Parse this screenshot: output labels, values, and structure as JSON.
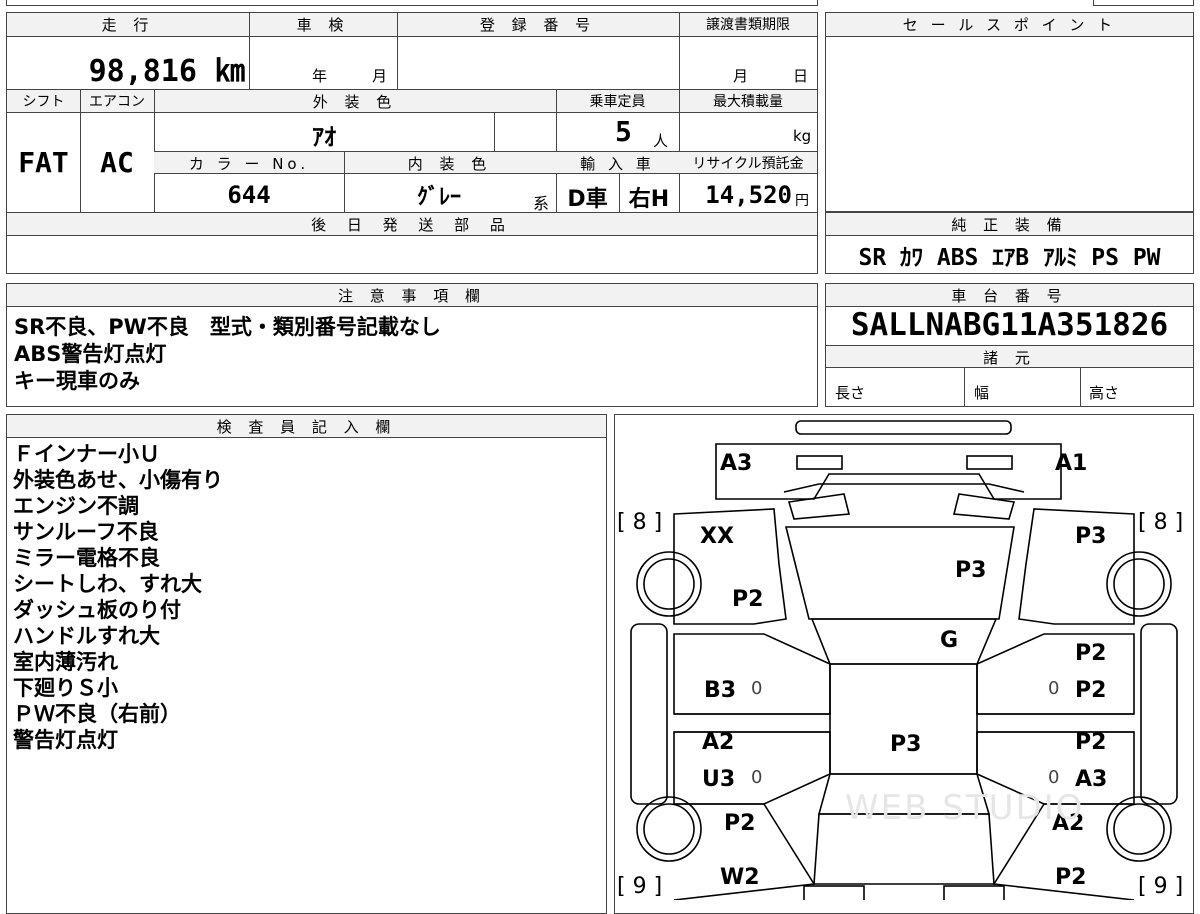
{
  "header_row": {
    "mileage_label": "走 行",
    "inspection_label": "車 検",
    "registration_label": "登 録 番 号",
    "transfer_deadline_label": "譲渡書類期限",
    "mileage_value": "98,816 ㎞",
    "inspection_year_unit": "年",
    "inspection_month_unit": "月",
    "transfer_month_unit": "月",
    "transfer_day_unit": "日"
  },
  "spec_row": {
    "shift_label": "シフト",
    "aircon_label": "エアコン",
    "exterior_color_label": "外 装 色",
    "capacity_label": "乗車定員",
    "max_load_label": "最大積載量",
    "shift_value": "FAT",
    "aircon_value": "AC",
    "exterior_color_value": "ｱｵ",
    "capacity_value": "5",
    "capacity_unit": "人",
    "max_load_unit": "kg",
    "color_no_label": "カ ラ ー No.",
    "interior_color_label": "内 装 色",
    "import_label": "輸 入 車",
    "recycle_label": "リサイクル預託金",
    "color_no_value": "644",
    "interior_color_value": "ｸﾞﾚｰ",
    "interior_suffix": "系",
    "import_value_1": "D車",
    "import_value_2": "右H",
    "recycle_value": "14,520",
    "recycle_unit": "円"
  },
  "later_parts_label": "後 日 発 送 部 品",
  "sales_point_label": "セ ー ル ス ポ イ ン ト",
  "genuine_equipment": {
    "label": "純 正 装 備",
    "value": "SR ｶﾜ ABS ｴｱB ｱﾙﾐ PS PW"
  },
  "notes": {
    "label": "注 意 事 項 欄",
    "lines": [
      "SR不良、PW不良　型式・類別番号記載なし",
      "ABS警告灯点灯",
      "キー現車のみ"
    ]
  },
  "chassis": {
    "label": "車 台 番 号",
    "value": "SALLNABG11A351826"
  },
  "specs": {
    "label": "諸 元",
    "length_label": "長さ",
    "width_label": "幅",
    "height_label": "高さ"
  },
  "inspector": {
    "label": "検 査 員 記 入 欄",
    "lines": [
      "Ｆインナー小Ｕ",
      "外装色あせ、小傷有り",
      "エンジン不調",
      "サンルーフ不良",
      "ミラー電格不良",
      "シートしわ、すれ大",
      "ダッシュ板のり付",
      "ハンドルすれ大",
      "室内薄汚れ",
      "下廻りＳ小",
      "ＰＷ不良（右前）",
      "警告灯点灯"
    ]
  },
  "diagram": {
    "labels": {
      "front_left": "A3",
      "front_right": "A1",
      "fl_fender": "XX",
      "fl_lower": "P2",
      "hood": "P3",
      "fr_fender": "P3",
      "windshield": "G",
      "rf_door_upper": "P2",
      "lf_door": "B3",
      "rf_door": "P2",
      "lr_door_a": "A2",
      "lr_door_b": "U3",
      "roof": "P3",
      "rr_door_a": "P2",
      "rr_door_b": "A3",
      "rear_left_fender": "P2",
      "rear_right_fender": "A2",
      "rear_left": "W2",
      "rear_right": "P2",
      "zero_1": "0",
      "zero_2": "0",
      "zero_3": "0",
      "zero_4": "0"
    },
    "tire_front_left": "[ 8 ]",
    "tire_front_right": "[ 8 ]",
    "tire_rear_left": "[ 9 ]",
    "tire_rear_right": "[ 9 ]",
    "watermark": "WEB STUDIO"
  }
}
